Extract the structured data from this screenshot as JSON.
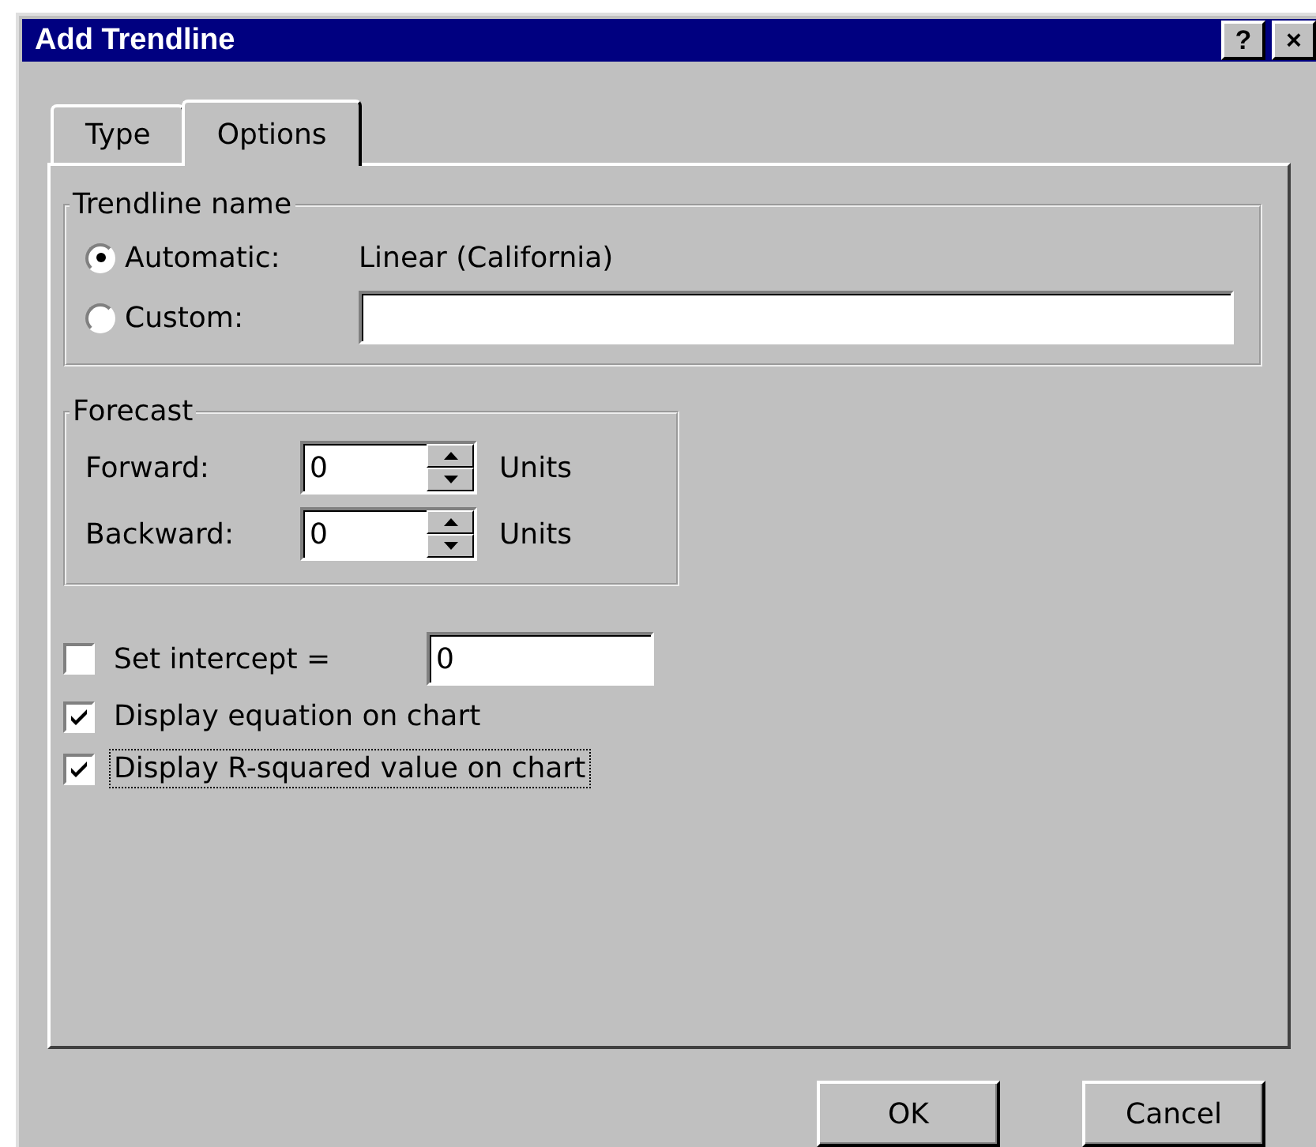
{
  "window": {
    "title": "Add Trendline",
    "help_button": "?",
    "close_button": "×"
  },
  "tabs": [
    {
      "label": "Type",
      "selected": false
    },
    {
      "label": "Options",
      "selected": true
    }
  ],
  "trendline_name": {
    "legend": "Trendline name",
    "options": [
      {
        "kind": "text",
        "label": "Automatic:",
        "selected": true,
        "value": "Linear (California)"
      },
      {
        "kind": "field",
        "label": "Custom:",
        "selected": false
      }
    ]
  },
  "forecast": {
    "legend": "Forecast",
    "rows": [
      {
        "label": "Forward:",
        "value": "0",
        "unit": "Units"
      },
      {
        "label": "Backward:",
        "value": "0",
        "unit": "Units"
      }
    ]
  },
  "options": [
    {
      "kind": "field",
      "label": "Set intercept =",
      "checked": false,
      "focused": false,
      "value": "0"
    },
    {
      "kind": "plain",
      "label": "Display equation on chart",
      "checked": true,
      "focused": false
    },
    {
      "kind": "plain",
      "label": "Display R-squared value on chart",
      "checked": true,
      "focused": true
    }
  ],
  "buttons": [
    {
      "label": "OK"
    },
    {
      "label": "Cancel"
    }
  ]
}
